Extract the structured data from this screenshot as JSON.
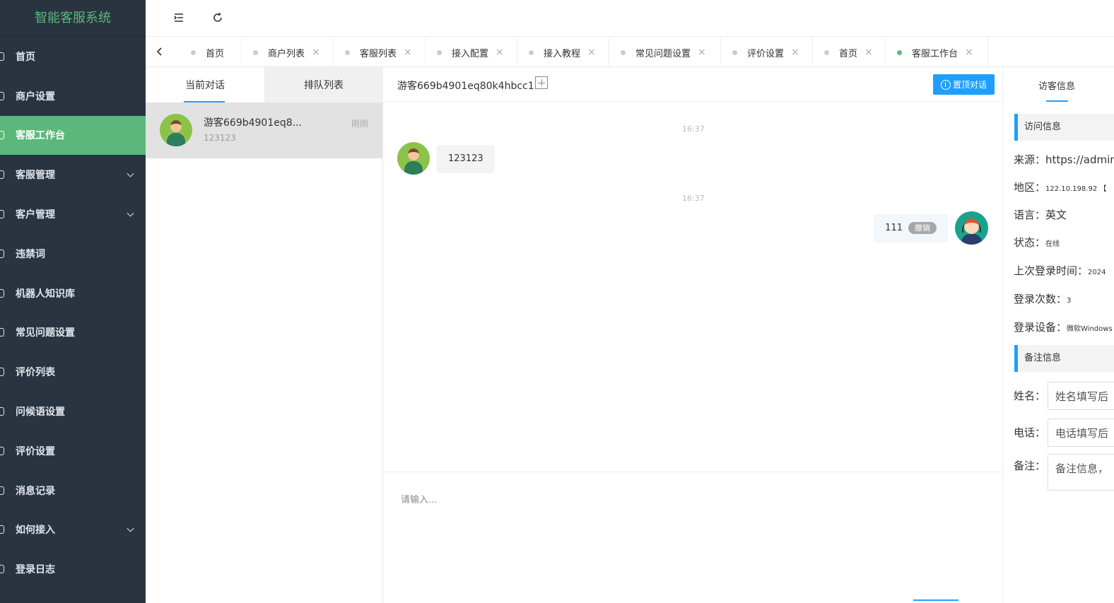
{
  "app": {
    "title": "智能客服系统"
  },
  "sidebar": {
    "items": [
      {
        "label": "首页",
        "icon": "home-icon"
      },
      {
        "label": "商户设置",
        "icon": "gear-icon"
      },
      {
        "label": "客服工作台",
        "icon": "headset-icon",
        "active": true
      },
      {
        "label": "客服管理",
        "icon": "user-icon",
        "expandable": true
      },
      {
        "label": "客户管理",
        "icon": "users-icon",
        "expandable": true
      },
      {
        "label": "违禁词",
        "icon": "frown-icon"
      },
      {
        "label": "机器人知识库",
        "icon": "robot-icon"
      },
      {
        "label": "常见问题设置",
        "icon": "edit-icon"
      },
      {
        "label": "评价列表",
        "icon": "thumb-icon"
      },
      {
        "label": "问候语设置",
        "icon": "send-icon"
      },
      {
        "label": "评价设置",
        "icon": "clipboard-icon"
      },
      {
        "label": "消息记录",
        "icon": "document-icon"
      },
      {
        "label": "如何接入",
        "icon": "link-icon",
        "expandable": true
      },
      {
        "label": "登录日志",
        "icon": "calendar-icon"
      }
    ]
  },
  "tabs": [
    {
      "label": "首页",
      "closable": false
    },
    {
      "label": "商户列表",
      "closable": true
    },
    {
      "label": "客服列表",
      "closable": true
    },
    {
      "label": "接入配置",
      "closable": true
    },
    {
      "label": "接入教程",
      "closable": true
    },
    {
      "label": "常见问题设置",
      "closable": true
    },
    {
      "label": "评价设置",
      "closable": true
    },
    {
      "label": "首页",
      "closable": true
    },
    {
      "label": "客服工作台",
      "closable": true,
      "active": true
    }
  ],
  "conversations": {
    "tab_current": "当前对话",
    "tab_queue": "排队列表",
    "items": [
      {
        "name": "游客669b4901eq8...",
        "preview": "123123",
        "time": "刚刚"
      }
    ]
  },
  "chat": {
    "title": "游客669b4901eq80k4hbcc1",
    "pin_button": "置顶对话",
    "messages": [
      {
        "time": "16:37",
        "from": "visitor",
        "text": "123123"
      },
      {
        "time": "16:37",
        "from": "agent",
        "text": "111",
        "revoke": "撤销"
      }
    ],
    "input_placeholder": "请输入..."
  },
  "visitor_info": {
    "tab": "访客信息",
    "visit_section": "访问信息",
    "source_label": "来源：",
    "source_value": "https://admin",
    "region_label": "地区：",
    "region_value": "122.10.198.92 【",
    "language_label": "语言：",
    "language_value": "英文",
    "status_label": "状态：",
    "status_value": "在线",
    "last_login_label": "上次登录时间：",
    "last_login_value": "2024",
    "login_count_label": "登录次数：",
    "login_count_value": "3",
    "device_label": "登录设备：",
    "device_value": "微软Windows",
    "note_section": "备注信息",
    "name_label": "姓名：",
    "name_placeholder": "姓名填写后",
    "phone_label": "电话：",
    "phone_placeholder": "电话填写后",
    "remark_label": "备注：",
    "remark_placeholder": "备注信息，"
  },
  "colors": {
    "sidebar": "#2a3441",
    "accent_green": "#5cb87a",
    "accent_blue": "#1e9fff"
  }
}
